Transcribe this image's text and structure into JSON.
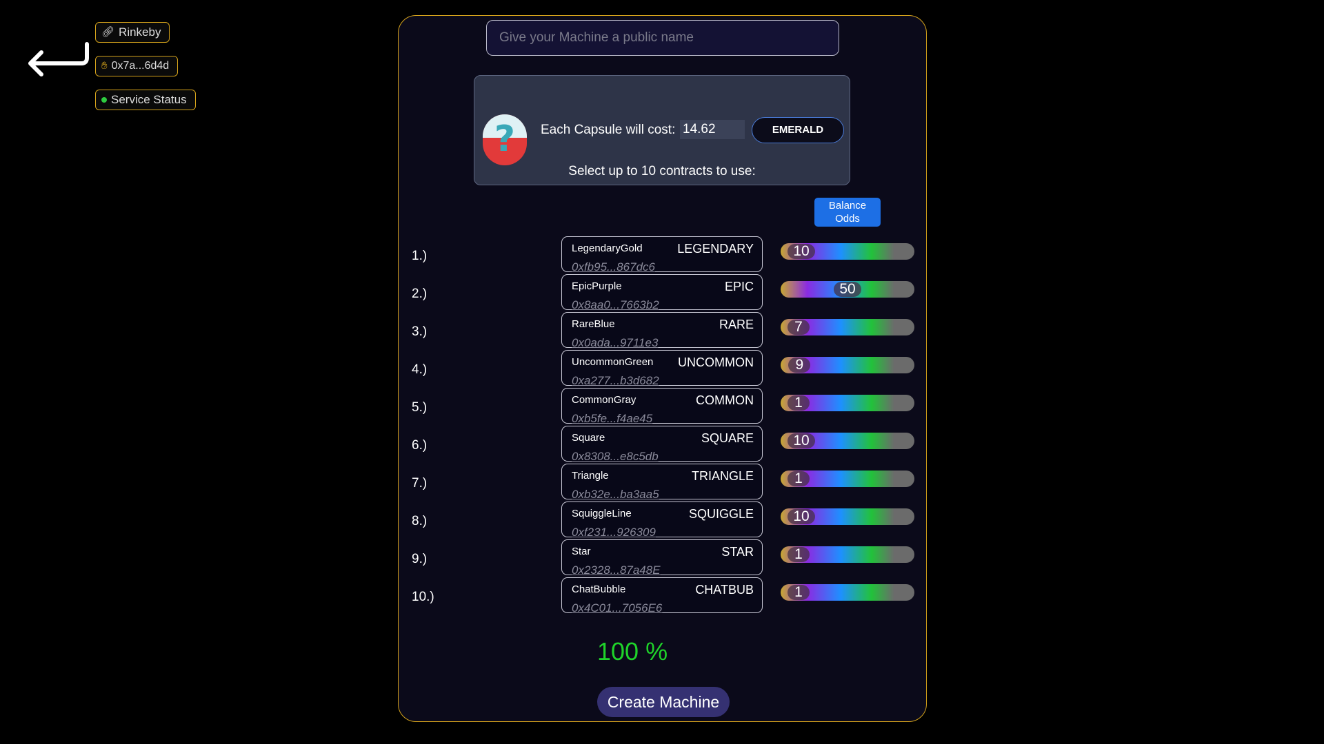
{
  "network": {
    "label": "Rinkeby",
    "icon": "link-icon"
  },
  "wallet": {
    "address": "0x7a...6d4d",
    "icon": "wave-hand-icon"
  },
  "service": {
    "label": "Service Status",
    "status_color": "#2ecc40"
  },
  "machine_name": {
    "placeholder": "Give your Machine a public name",
    "value": ""
  },
  "cost": {
    "label": "Each Capsule will cost:",
    "value": "14.62",
    "currency": "EMERALD",
    "select_label": "Select up to 10 contracts to use:"
  },
  "balance_odds_label_1": "Balance",
  "balance_odds_label_2": "Odds",
  "contracts": [
    {
      "num": "1.)",
      "name": "LegendaryGold",
      "symbol": "LEGENDARY",
      "address": "0xfb95...867dc6",
      "odds": "10",
      "level": 10
    },
    {
      "num": "2.)",
      "name": "EpicPurple",
      "symbol": "EPIC",
      "address": "0x8aa0...7663b2",
      "odds": "50",
      "level": 50
    },
    {
      "num": "3.)",
      "name": "RareBlue",
      "symbol": "RARE",
      "address": "0x0ada...9711e3",
      "odds": "7",
      "level": 7
    },
    {
      "num": "4.)",
      "name": "UncommonGreen",
      "symbol": "UNCOMMON",
      "address": "0xa277...b3d682",
      "odds": "9",
      "level": 9
    },
    {
      "num": "5.)",
      "name": "CommonGray",
      "symbol": "COMMON",
      "address": "0xb5fe...f4ae45",
      "odds": "1",
      "level": 1
    },
    {
      "num": "6.)",
      "name": "Square",
      "symbol": "SQUARE",
      "address": "0x8308...e8c5db",
      "odds": "10",
      "level": 10
    },
    {
      "num": "7.)",
      "name": "Triangle",
      "symbol": "TRIANGLE",
      "address": "0xb32e...ba3aa5",
      "odds": "1",
      "level": 1
    },
    {
      "num": "8.)",
      "name": "SquiggleLine",
      "symbol": "SQUIGGLE",
      "address": "0xf231...926309",
      "odds": "10",
      "level": 10
    },
    {
      "num": "9.)",
      "name": "Star",
      "symbol": "STAR",
      "address": "0x2328...87a48E",
      "odds": "1",
      "level": 1
    },
    {
      "num": "10.)",
      "name": "ChatBubble",
      "symbol": "CHATBUB",
      "address": "0x4C01...7056E6",
      "odds": "1",
      "level": 1
    }
  ],
  "total_percent": "100 %",
  "create_label": "Create Machine",
  "colors": {
    "accent_border": "#d4a21b",
    "percent": "#1fd32a",
    "button": "#353172",
    "balance_button": "#1d6fe5"
  }
}
